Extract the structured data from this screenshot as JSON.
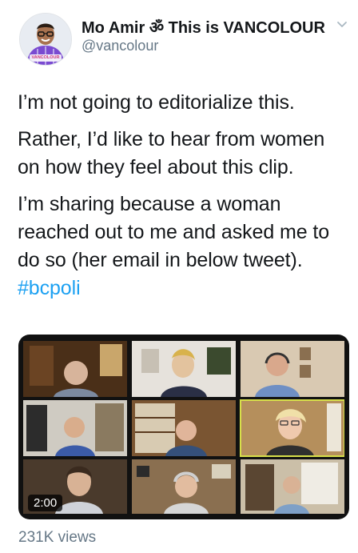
{
  "author": {
    "display_name": "Mo Amir ॐ This is VANCOLOUR",
    "handle": "@vancolour",
    "avatar_caption": "VANCOLOUR"
  },
  "tweet": {
    "paragraphs": [
      "I’m not going to editorialize this.",
      "Rather, I’d like to hear from women on how they feel about this clip.",
      "I’m sharing because a woman reached out to me and asked me to do so (her email in below tweet)."
    ],
    "hashtag": "#bcpoli"
  },
  "video": {
    "timestamp": "2:00",
    "participants": [
      {
        "tile": "row1-col1",
        "shirt": "#7c8aa0",
        "wall": "#5a3a1e"
      },
      {
        "tile": "row1-col2",
        "shirt": "#2a2f45",
        "wall": "#e6e2dc"
      },
      {
        "tile": "row1-col3",
        "shirt": "#6f8fc4",
        "wall": "#d9c9b2"
      },
      {
        "tile": "row2-col1",
        "shirt": "#3b5ba8",
        "wall": "#cfcbc2"
      },
      {
        "tile": "row2-col2",
        "shirt": "#35507a",
        "wall": "#7a5532"
      },
      {
        "tile": "row2-col3",
        "shirt": "#2f2f2f",
        "wall": "#b58f5c"
      },
      {
        "tile": "row3-col1",
        "shirt": "#cfd2d8",
        "wall": "#4a3a2c"
      },
      {
        "tile": "row3-col2",
        "shirt": "#d6d6d6",
        "wall": "#8a6f50"
      },
      {
        "tile": "row3-col3",
        "shirt": "#7ea0c7",
        "wall": "#cbbfa8"
      }
    ]
  },
  "stats": {
    "views": "231K views"
  },
  "colors": {
    "accent": "#1da1f2",
    "secondary_text": "#657786",
    "primary_text": "#14171a"
  }
}
